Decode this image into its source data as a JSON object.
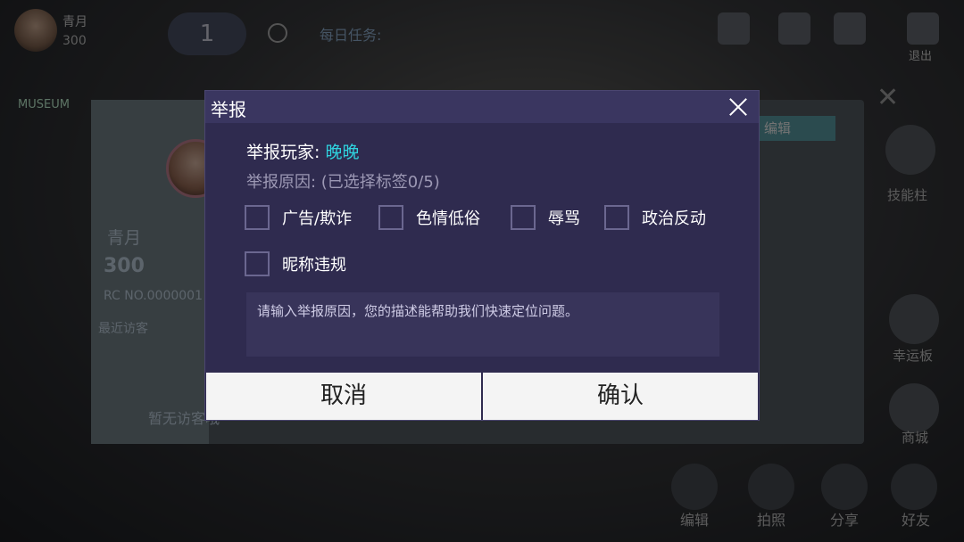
{
  "background": {
    "player_name": "青月",
    "player_coins": "300",
    "level": "1",
    "daily_task": "每日任务:",
    "exit_label": "退出",
    "card": {
      "museum_text": "MUSEUM",
      "location": "青月",
      "coins": "300",
      "id": "RC NO.0000001",
      "recent_visitors": "最近访客",
      "no_visitors": "暂无访客哦",
      "edit": "编辑"
    },
    "side": {
      "skill_label": "技能柱",
      "draw_label": "幸运板",
      "shop_label": "商城"
    },
    "bottom": {
      "edit": "编辑",
      "photo": "拍照",
      "share": "分享",
      "friends": "好友"
    }
  },
  "dialog": {
    "title": "举报",
    "player_label": "举报玩家:",
    "player_name": "晚晚",
    "reason_label": "举报原因: (已选择标签0/5)",
    "tags": [
      "广告/欺诈",
      "色情低俗",
      "辱骂",
      "政治反动",
      "昵称违规"
    ],
    "input_placeholder": "请输入举报原因，您的描述能帮助我们快速定位问题。",
    "cancel_label": "取消",
    "confirm_label": "确认",
    "accent_color": "#2fd3df"
  }
}
